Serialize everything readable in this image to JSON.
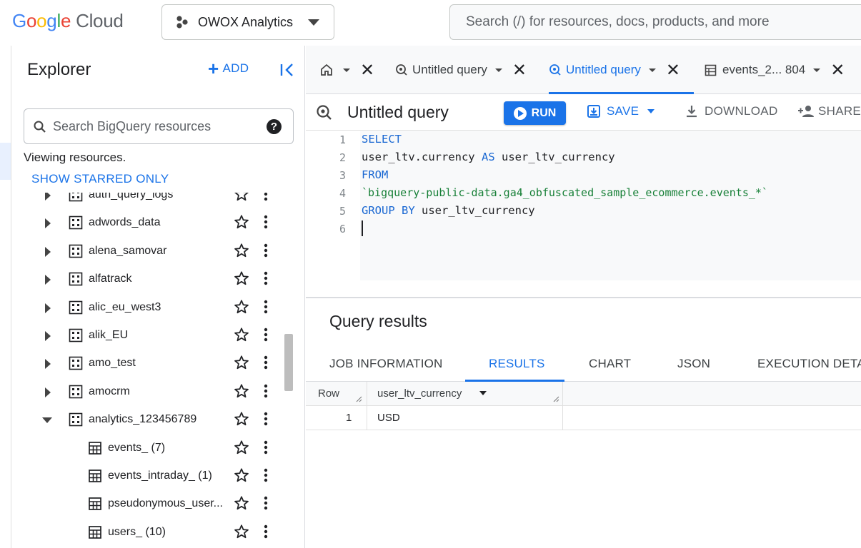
{
  "header": {
    "logo_google": "Google",
    "logo_cloud": "Cloud",
    "project_name": "OWOX Analytics",
    "search_placeholder": "Search (/) for resources, docs, products, and more"
  },
  "explorer": {
    "title": "Explorer",
    "add_label": "ADD",
    "search_placeholder": "Search BigQuery resources",
    "help_glyph": "?",
    "viewing_text": "Viewing resources.",
    "starred_label": "SHOW STARRED ONLY",
    "datasets": [
      {
        "label": "auth_query_logs",
        "expanded": false
      },
      {
        "label": "adwords_data",
        "expanded": false
      },
      {
        "label": "alena_samovar",
        "expanded": false
      },
      {
        "label": "alfatrack",
        "expanded": false
      },
      {
        "label": "alic_eu_west3",
        "expanded": false
      },
      {
        "label": "alik_EU",
        "expanded": false
      },
      {
        "label": "amo_test",
        "expanded": false
      },
      {
        "label": "amocrm",
        "expanded": false
      },
      {
        "label": "analytics_123456789",
        "expanded": true
      }
    ],
    "tables": [
      {
        "label": "events_ (7)"
      },
      {
        "label": "events_intraday_ (1)"
      },
      {
        "label": "pseudonymous_user..."
      },
      {
        "label": "users_ (10)"
      }
    ]
  },
  "tabs": [
    {
      "label": "Untitled query",
      "active": false
    },
    {
      "label": "Untitled query",
      "active": true
    },
    {
      "label": "events_2... 804",
      "active": false
    }
  ],
  "toolbar": {
    "title": "Untitled query",
    "run_label": "RUN",
    "save_label": "SAVE",
    "download_label": "DOWNLOAD",
    "share_label": "SHARE"
  },
  "editor": {
    "line_numbers": [
      "1",
      "2",
      "3",
      "4",
      "5",
      "6"
    ],
    "line1_kw": "SELECT",
    "line2_a": "user_ltv.currency ",
    "line2_kw": "AS",
    "line2_b": " user_ltv_currency",
    "line3_kw": "FROM",
    "line4_str": "`bigquery-public-data.ga4_obfuscated_sample_ecommerce.events_*`",
    "line5_kw": "GROUP BY",
    "line5_b": " user_ltv_currency"
  },
  "results": {
    "title": "Query results",
    "tabs": [
      "JOB INFORMATION",
      "RESULTS",
      "CHART",
      "JSON",
      "EXECUTION DETA"
    ],
    "active_tab": "RESULTS",
    "columns": [
      "Row",
      "user_ltv_currency"
    ],
    "rows": [
      [
        "1",
        "USD"
      ]
    ]
  },
  "colors": {
    "accent": "#1a73e8",
    "keyword": "#1967d2",
    "string": "#188038"
  }
}
